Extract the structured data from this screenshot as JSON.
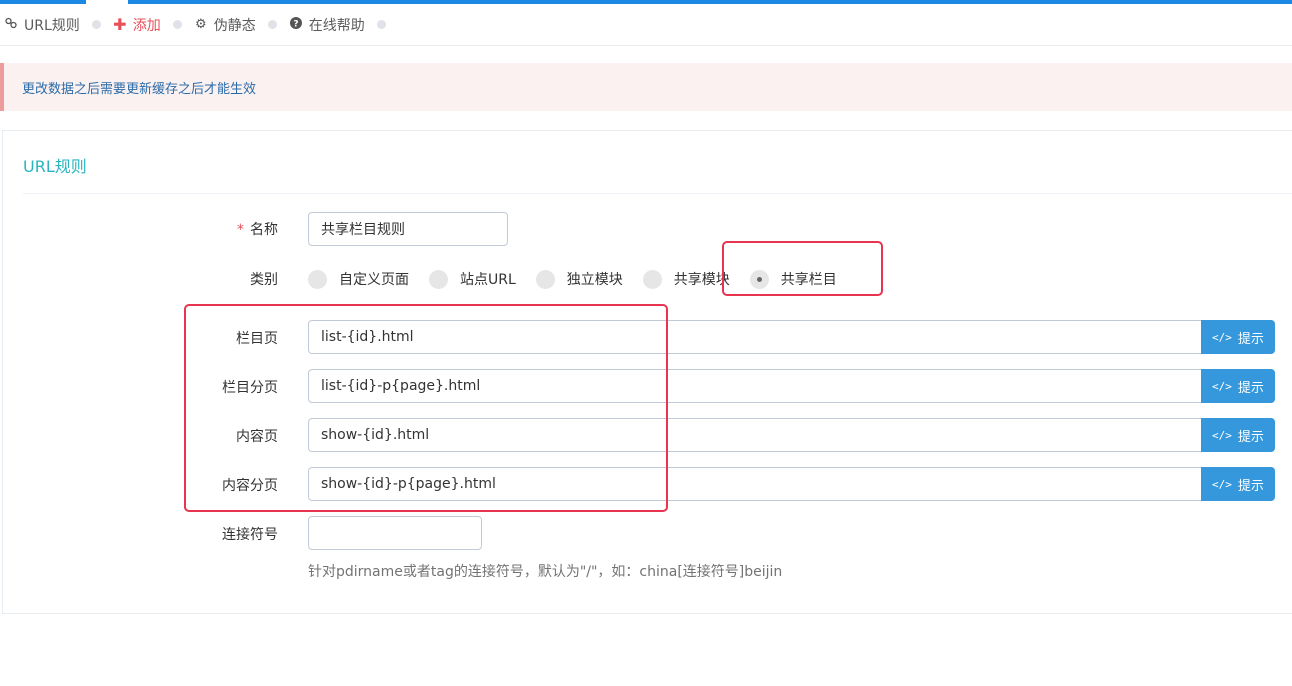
{
  "nav": {
    "items": [
      {
        "icon": "link-icon",
        "label": "URL规则"
      },
      {
        "icon": "plus-icon",
        "label": "添加"
      },
      {
        "icon": "gear-icon",
        "label": "伪静态"
      },
      {
        "icon": "question-circle-icon",
        "label": "在线帮助"
      }
    ]
  },
  "alert": {
    "text": "更改数据之后需要更新缓存之后才能生效"
  },
  "portlet": {
    "title": "URL规则"
  },
  "form": {
    "name": {
      "label": "名称",
      "required_mark": "*",
      "value": "共享栏目规则"
    },
    "type": {
      "label": "类别",
      "options": [
        "自定义页面",
        "站点URL",
        "独立模块",
        "共享模块",
        "共享栏目"
      ],
      "selected": "共享栏目"
    },
    "rules": [
      {
        "label": "栏目页",
        "value": "list-{id}.html",
        "button": "提示"
      },
      {
        "label": "栏目分页",
        "value": "list-{id}-p{page}.html",
        "button": "提示"
      },
      {
        "label": "内容页",
        "value": "show-{id}.html",
        "button": "提示"
      },
      {
        "label": "内容分页",
        "value": "show-{id}-p{page}.html",
        "button": "提示"
      }
    ],
    "connector": {
      "label": "连接符号",
      "value": "",
      "help": "针对pdirname或者tag的连接符号，默认为\"/\"，如：china[连接符号]beijin"
    }
  },
  "colors": {
    "accent": "#1e88e5",
    "active_nav": "#e7505a",
    "button": "#3598dc",
    "highlight": "#e8344e",
    "title": "#2ab4c0"
  }
}
